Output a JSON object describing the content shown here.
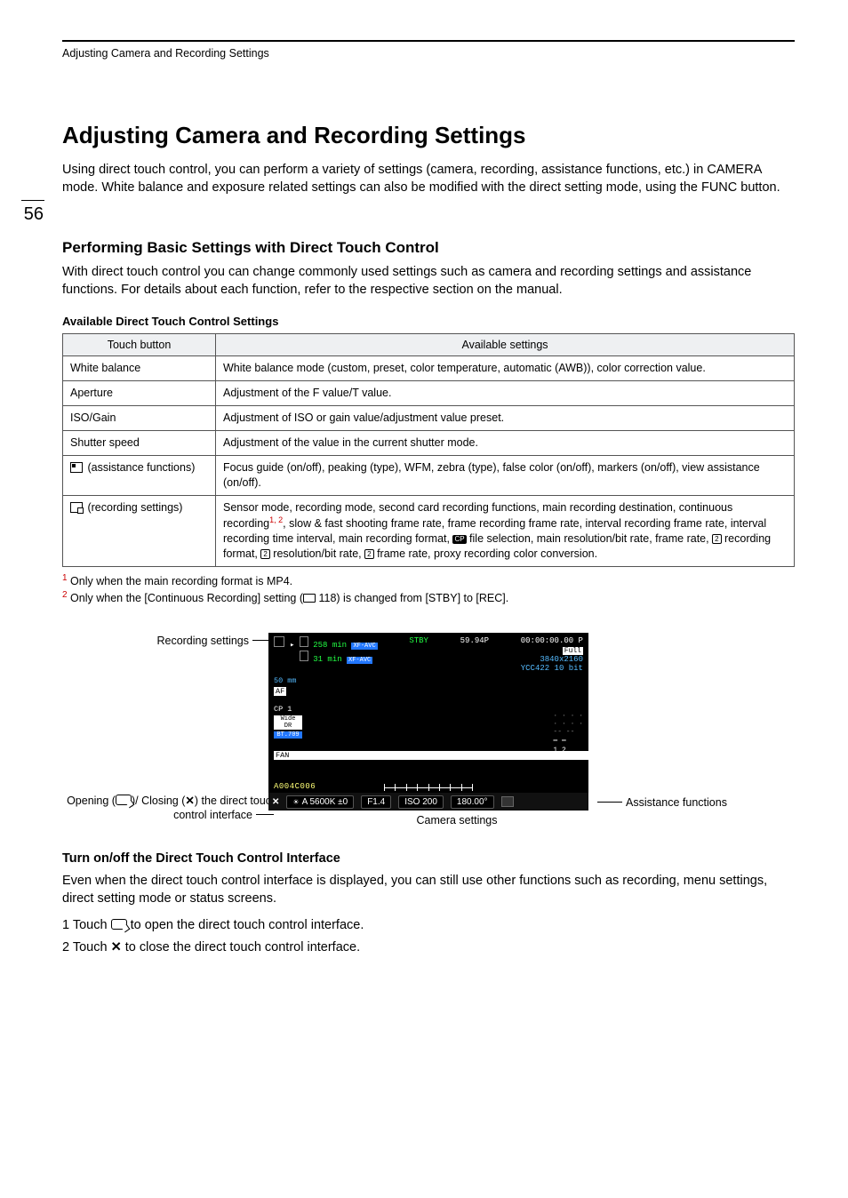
{
  "page": {
    "number": "56",
    "running_head": "Adjusting Camera and Recording Settings"
  },
  "h1": "Adjusting Camera and Recording Settings",
  "intro": "Using direct touch control, you can perform a variety of settings (camera, recording, assistance functions, etc.) in CAMERA mode. White balance and exposure related settings can also be modified with the direct setting mode, using the FUNC button.",
  "h2": "Performing Basic Settings with Direct Touch Control",
  "h2_body": "With direct touch control you can change commonly used settings such as camera and recording settings and assistance functions. For details about each function, refer to the respective section on the manual.",
  "table_title": "Available Direct Touch Control Settings",
  "table": {
    "headers": [
      "Touch button",
      "Available settings"
    ],
    "rows": [
      {
        "button": "White balance",
        "settings": "White balance mode (custom, preset, color temperature, automatic (AWB)), color correction value."
      },
      {
        "button": "Aperture",
        "settings": "Adjustment of the F value/T value."
      },
      {
        "button": "ISO/Gain",
        "settings": "Adjustment of ISO or gain value/adjustment value preset."
      },
      {
        "button": "Shutter speed",
        "settings": "Adjustment of the value in the current shutter mode."
      },
      {
        "button_icon": "assist",
        "button": " (assistance functions)",
        "settings": "Focus guide (on/off), peaking (type), WFM, zebra (type), false color (on/off), markers (on/off), view assistance (on/off)."
      },
      {
        "button_icon": "record",
        "button": " (recording settings)",
        "settings_pre": "Sensor mode, recording mode, second card recording functions, main recording destination, continuous recording",
        "settings_sup": "1, 2",
        "settings_mid": ", slow & fast shooting frame rate, frame recording frame rate, interval recording frame rate, interval recording time interval, main recording format, ",
        "chip_cp": "CP",
        "settings_mid2": " file selection, main resolution/bit rate, frame rate, ",
        "chip2a": "2",
        "settings_a": " recording format, ",
        "chip2b": "2",
        "settings_b": " resolution/bit rate, ",
        "chip2c": "2",
        "settings_c": " frame rate, proxy recording color conversion."
      }
    ]
  },
  "footnotes": {
    "f1_num": "1",
    "f1": " Only when the main recording format is MP4.",
    "f2_num": "2",
    "f2a": " Only when the [Continuous Recording] setting (",
    "f2_page": " 118) is changed from [STBY] to [REC]."
  },
  "figure": {
    "label_recording": "Recording settings",
    "label_open_close": "Opening (",
    "label_open_close_mid": ")/ Closing (",
    "label_open_close_end": ") the direct touch control interface",
    "label_assist": "Assistance functions",
    "label_camera": "Camera settings",
    "monitor": {
      "card1_time": "258 min",
      "card2_time": "31 min",
      "codec": "XF-AVC",
      "stby": "STBY",
      "fps": "59.94P",
      "tc": "00:00:00.00 P",
      "full": "Full",
      "res": "3840x2160",
      "sampling": "YCC422 10 bit",
      "focal": "50 mm",
      "af": "AF",
      "cp": "CP 1",
      "wide": "Wide DR",
      "bt709": "BT.709",
      "fan": "FAN",
      "clip": "A004C006",
      "wb": "A 5600K ±0",
      "f": "F1.4",
      "iso": "ISO 200",
      "shutter": "180.00°",
      "audio12": "1  2"
    }
  },
  "sub3": "Turn on/off the Direct Touch Control Interface",
  "sub3_body": "Even when the direct touch control interface is displayed, you can still use other functions such as recording, menu settings, direct setting mode or status screens.",
  "steps": {
    "s1a": "1 Touch ",
    "s1b": " to open the direct touch control interface.",
    "s2a": "2 Touch ",
    "s2b": " to close the direct touch control interface."
  }
}
